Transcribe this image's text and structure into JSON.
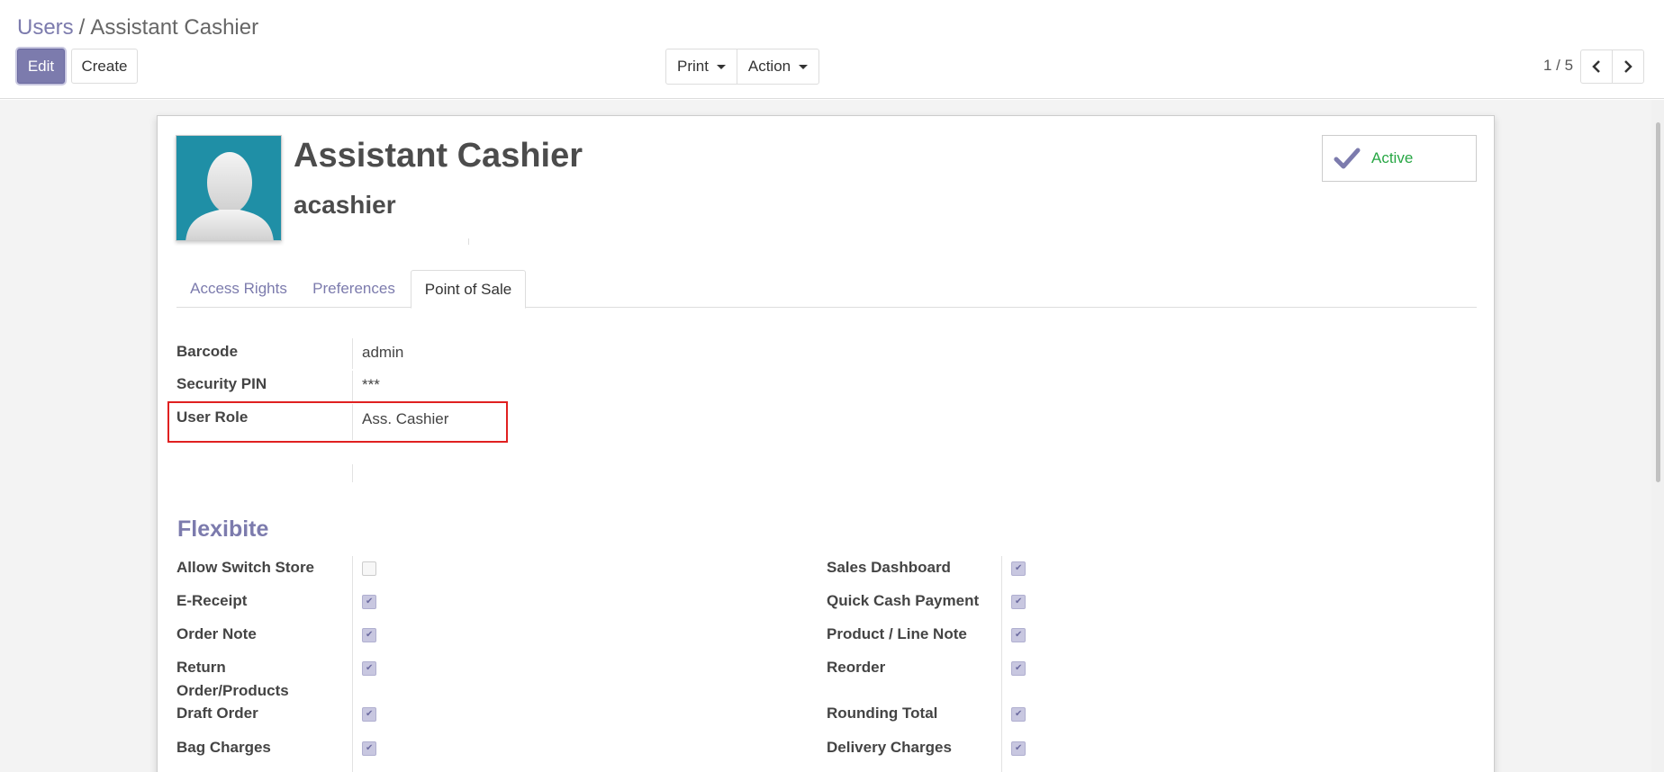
{
  "breadcrumb": {
    "parent": "Users",
    "separator": "/",
    "current": "Assistant Cashier"
  },
  "toolbar": {
    "edit_label": "Edit",
    "create_label": "Create",
    "print_label": "Print",
    "action_label": "Action"
  },
  "pager": {
    "value": "1 / 5"
  },
  "record": {
    "name": "Assistant Cashier",
    "login": "acashier",
    "active_label": "Active"
  },
  "tabs": [
    {
      "label": "Access Rights",
      "active": false
    },
    {
      "label": "Preferences",
      "active": false
    },
    {
      "label": "Point of Sale",
      "active": true
    }
  ],
  "pos_fields": {
    "barcode": {
      "label": "Barcode",
      "value": "admin"
    },
    "security_pin": {
      "label": "Security PIN",
      "value": "***"
    },
    "user_role": {
      "label": "User Role",
      "value": "Ass. Cashier"
    }
  },
  "section": {
    "title": "Flexibite"
  },
  "left_options": [
    {
      "label": "Allow Switch Store",
      "checked": false
    },
    {
      "label": "E-Receipt",
      "checked": true
    },
    {
      "label": "Order Note",
      "checked": true
    },
    {
      "label_line1": "Return",
      "label_line2": "Order/Products",
      "checked": true
    },
    {
      "label": "Draft Order",
      "checked": true
    },
    {
      "label": "Bag Charges",
      "checked": true
    }
  ],
  "right_options": [
    {
      "label": "Sales Dashboard",
      "checked": true
    },
    {
      "label": "Quick Cash Payment",
      "checked": true
    },
    {
      "label": "Product / Line Note",
      "checked": true
    },
    {
      "label": "Reorder",
      "checked": true
    },
    {
      "label": "Rounding Total",
      "checked": true
    },
    {
      "label": "Delivery Charges",
      "checked": true
    }
  ],
  "colors": {
    "accent": "#7c7bad",
    "active_green": "#28a745",
    "avatar_bg": "#1f8fa6",
    "highlight_red": "#e02020"
  }
}
